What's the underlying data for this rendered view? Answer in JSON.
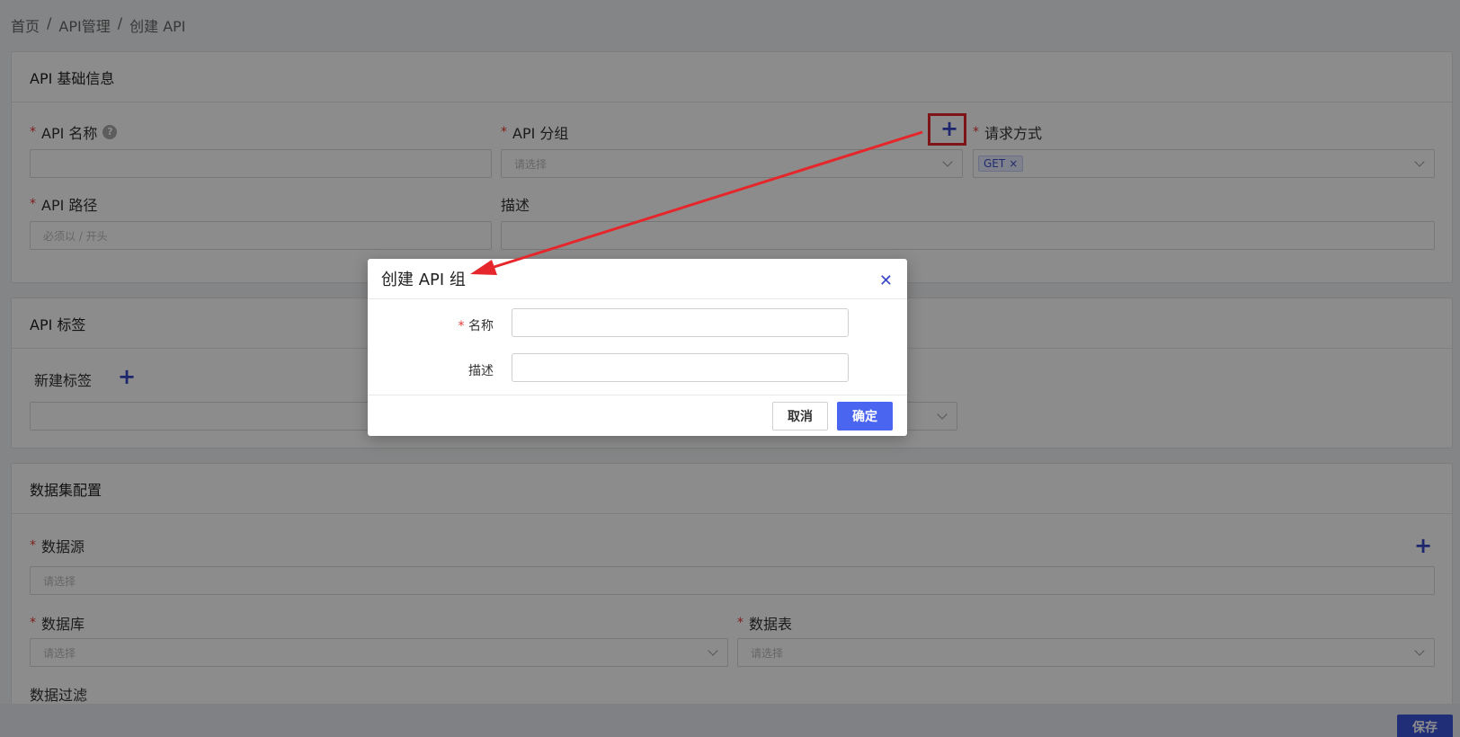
{
  "breadcrumb": {
    "items": [
      "首页",
      "API管理",
      "创建 API"
    ],
    "separator": "/"
  },
  "basic_info": {
    "title": "API 基础信息",
    "api_name_label": "API 名称",
    "api_group_label": "API 分组",
    "api_group_placeholder": "请选择",
    "request_method_label": "请求方式",
    "request_method_tag": "GET",
    "api_path_label": "API 路径",
    "api_path_placeholder": "必须以 / 开头",
    "description_label": "描述"
  },
  "tags_section": {
    "title": "API 标签",
    "new_tag_label": "新建标签"
  },
  "dataset_section": {
    "title": "数据集配置",
    "datasource_label": "数据源",
    "datasource_placeholder": "请选择",
    "database_label": "数据库",
    "database_placeholder": "请选择",
    "table_label": "数据表",
    "table_placeholder": "请选择",
    "filter_label": "数据过滤"
  },
  "footer": {
    "save_label": "保存"
  },
  "modal": {
    "title": "创建 API 组",
    "name_label": "名称",
    "description_label": "描述",
    "cancel_label": "取消",
    "confirm_label": "确定"
  },
  "colors": {
    "accent": "#4a66f0",
    "required": "#e53935",
    "annotation": "#e5262a"
  }
}
